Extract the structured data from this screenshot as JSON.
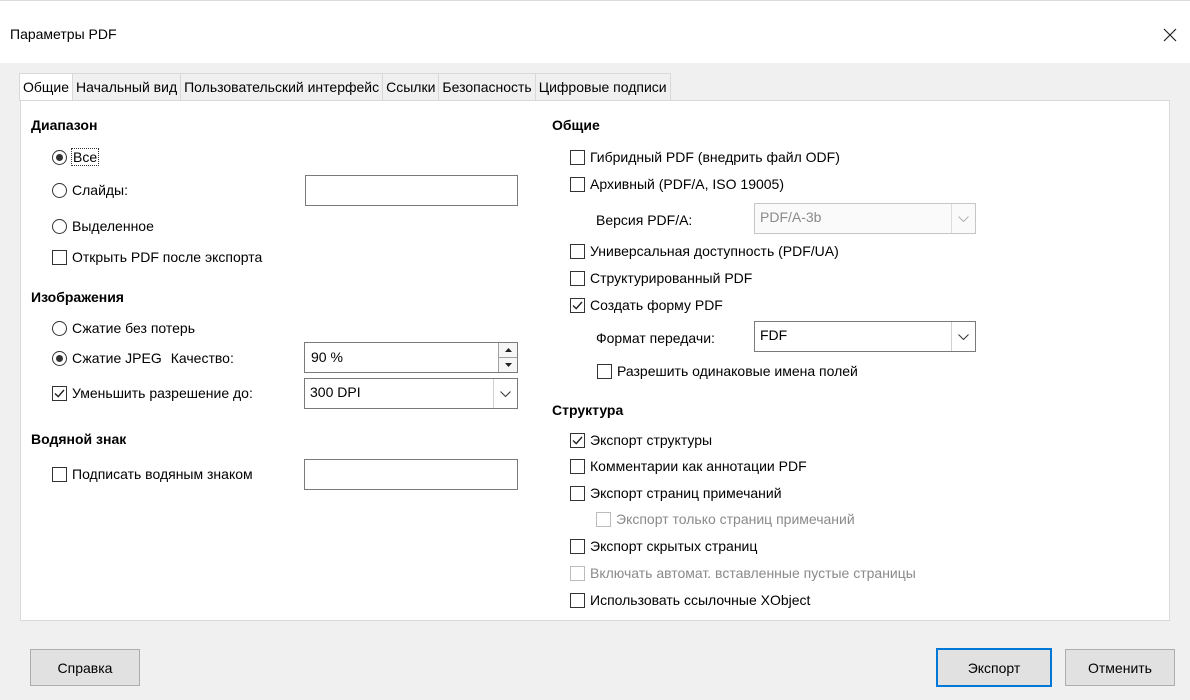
{
  "window": {
    "title": "Параметры PDF"
  },
  "tabs": [
    {
      "label": "Общие"
    },
    {
      "label": "Начальный вид"
    },
    {
      "label": "Пользовательский интерфейс"
    },
    {
      "label": "Ссылки"
    },
    {
      "label": "Безопасность"
    },
    {
      "label": "Цифровые подписи"
    }
  ],
  "range": {
    "heading": "Диапазон",
    "all": "Все",
    "slides": "Слайды:",
    "slides_value": "",
    "selection": "Выделенное",
    "open_after": "Открыть PDF после экспорта"
  },
  "images": {
    "heading": "Изображения",
    "lossless": "Сжатие без потерь",
    "jpeg": "Сжатие JPEG",
    "quality_label": "Качество:",
    "quality_value": "90 %",
    "reduce": "Уменьшить разрешение до:",
    "reduce_value": "300 DPI"
  },
  "watermark": {
    "heading": "Водяной знак",
    "sign": "Подписать водяным знаком",
    "sign_value": ""
  },
  "general": {
    "heading": "Общие",
    "hybrid": "Гибридный PDF (внедрить файл ODF)",
    "archive": "Архивный (PDF/A, ISO 19005)",
    "pdfa_version_label": "Версия PDF/A:",
    "pdfa_version_value": "PDF/A-3b",
    "accessibility": "Универсальная доступность (PDF/UA)",
    "tagged": "Структурированный PDF",
    "create_form": "Создать форму PDF",
    "submit_format_label": "Формат передачи:",
    "submit_format_value": "FDF",
    "allow_duplicate": "Разрешить одинаковые имена полей"
  },
  "structure": {
    "heading": "Структура",
    "export_outlines": "Экспорт структуры",
    "comments": "Комментарии как аннотации PDF",
    "export_notes": "Экспорт страниц примечаний",
    "notes_only": "Экспорт только страниц примечаний",
    "hidden_pages": "Экспорт скрытых страниц",
    "auto_blank": "Включать автомат. вставленные пустые страницы",
    "xobjects": "Использовать ссылочные XObject"
  },
  "buttons": {
    "help": "Справка",
    "export": "Экспорт",
    "cancel": "Отменить"
  }
}
